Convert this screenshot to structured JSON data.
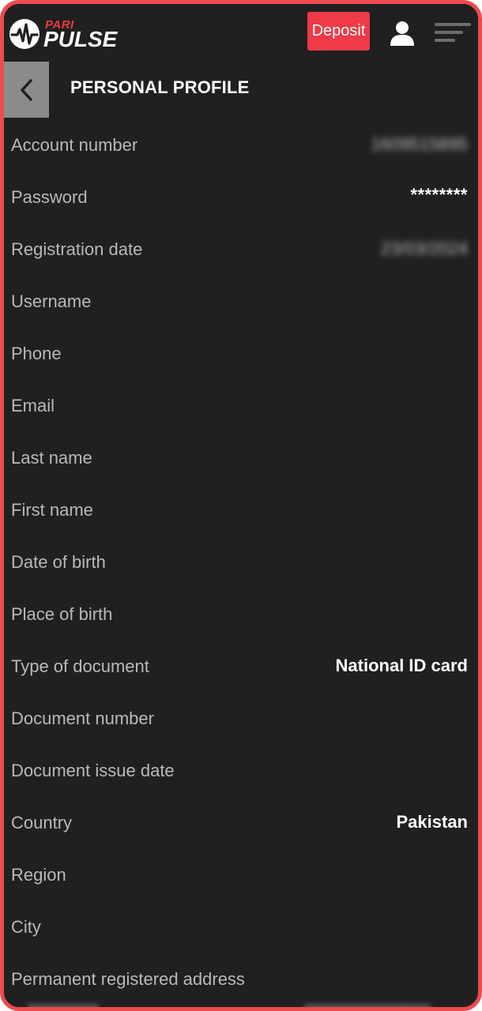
{
  "header": {
    "logo_top": "PARI",
    "logo_bottom": "PULSE",
    "deposit_label": "Deposit"
  },
  "page": {
    "title": "PERSONAL PROFILE"
  },
  "fields": [
    {
      "label": "Account number",
      "value": "1609515895"
    },
    {
      "label": "Password",
      "value": "********"
    },
    {
      "label": "Registration date",
      "value": "23/03/2024"
    },
    {
      "label": "Username",
      "value": ""
    },
    {
      "label": "Phone",
      "value": ""
    },
    {
      "label": "Email",
      "value": ""
    },
    {
      "label": "Last name",
      "value": ""
    },
    {
      "label": "First name",
      "value": ""
    },
    {
      "label": "Date of birth",
      "value": ""
    },
    {
      "label": "Place of birth",
      "value": ""
    },
    {
      "label": "Type of document",
      "value": "National ID card"
    },
    {
      "label": "Document number",
      "value": ""
    },
    {
      "label": "Document issue date",
      "value": ""
    },
    {
      "label": "Country",
      "value": "Pakistan"
    },
    {
      "label": "Region",
      "value": ""
    },
    {
      "label": "City",
      "value": ""
    },
    {
      "label": "Permanent registered address",
      "value": ""
    }
  ],
  "colors": {
    "accent": "#ee3b47",
    "background": "#202020",
    "frame": "#ee4b4f"
  }
}
